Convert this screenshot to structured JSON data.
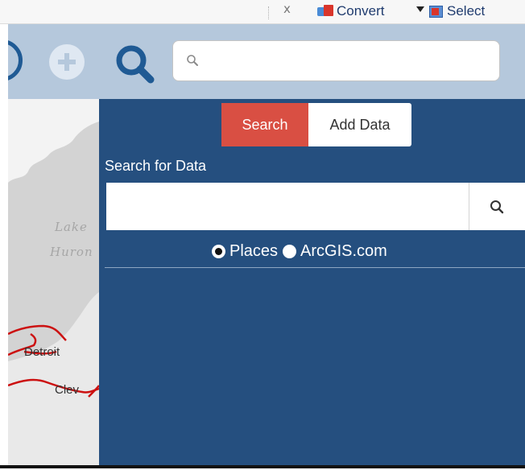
{
  "browser_toolbar": {
    "close_label": "x",
    "convert_label": "Convert",
    "select_label": "Select"
  },
  "app_toolbar": {
    "search_placeholder": ""
  },
  "map": {
    "labels": {
      "lake": "Lake",
      "huron": "Huron",
      "detroit": "Detroit",
      "clev": "Clev"
    }
  },
  "panel": {
    "tabs": [
      {
        "label": "Search",
        "active": true
      },
      {
        "label": "Add Data",
        "active": false
      }
    ],
    "heading": "Search for Data",
    "search_value": "",
    "radio_options": [
      {
        "label": "Places",
        "checked": true
      },
      {
        "label": "ArcGIS.com",
        "checked": false
      }
    ]
  },
  "colors": {
    "panel_bg": "#254f7f",
    "active_tab": "#d94f43",
    "toolbar_bg": "#b5c8dc",
    "road": "#cc1111"
  }
}
